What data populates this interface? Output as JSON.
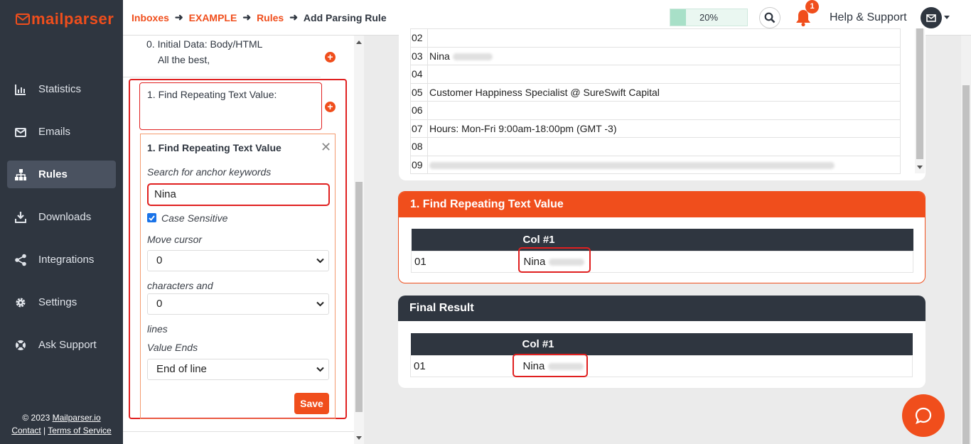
{
  "app": {
    "brand": "mailparser",
    "accent": "#f04e1c",
    "sidebar_bg": "#2f3640"
  },
  "sidebar": {
    "items": [
      {
        "label": "Statistics",
        "icon": "bar-chart-icon"
      },
      {
        "label": "Emails",
        "icon": "envelope-icon"
      },
      {
        "label": "Rules",
        "icon": "sitemap-icon"
      },
      {
        "label": "Downloads",
        "icon": "download-icon"
      },
      {
        "label": "Integrations",
        "icon": "share-icon"
      },
      {
        "label": "Settings",
        "icon": "gear-icon"
      },
      {
        "label": "Ask Support",
        "icon": "lifebuoy-icon"
      }
    ],
    "active": "Rules",
    "copyright_prefix": "© 2023 ",
    "copyright_link": "Mailparser.io",
    "contact": "Contact",
    "separator": "|",
    "terms": "Terms of Service"
  },
  "breadcrumb": [
    "Inboxes",
    "EXAMPLE",
    "Rules",
    "Add Parsing Rule"
  ],
  "topbar": {
    "progress": 20,
    "progress_label": "20%",
    "notification_count": "1",
    "help": "Help & Support"
  },
  "rules_panel": {
    "step0_title": "0. Initial Data: Body/HTML",
    "step0_preview": "All the best,",
    "step1_title": "1. Find Repeating Text Value:",
    "editor": {
      "title": "1. Find Repeating Text Value",
      "anchor_label": "Search for anchor keywords",
      "anchor_value": "Nina",
      "case_sensitive_label": "Case Sensitive",
      "case_sensitive": true,
      "move_cursor_label": "Move cursor",
      "move_cursor_value": "0",
      "characters_label": "characters and",
      "characters_value": "0",
      "lines_label": "lines",
      "value_ends_label": "Value Ends",
      "value_ends_value": "End of line",
      "save": "Save"
    }
  },
  "email_lines": [
    {
      "n": "02",
      "text": ""
    },
    {
      "n": "03",
      "text": "Nina"
    },
    {
      "n": "04",
      "text": ""
    },
    {
      "n": "05",
      "text": "Customer Happiness Specialist @ SureSwift Capital"
    },
    {
      "n": "06",
      "text": ""
    },
    {
      "n": "07",
      "text": "Hours: Mon-Fri 9:00am-18:00pm (GMT -3)"
    },
    {
      "n": "08",
      "text": ""
    },
    {
      "n": "09",
      "text": ""
    }
  ],
  "result_card": {
    "title": "1. Find Repeating Text Value",
    "col": "Col #1",
    "row_n": "01",
    "row_value": "Nina"
  },
  "final_card": {
    "title": "Final Result",
    "col": "Col #1",
    "row_n": "01",
    "row_value": "Nina"
  }
}
